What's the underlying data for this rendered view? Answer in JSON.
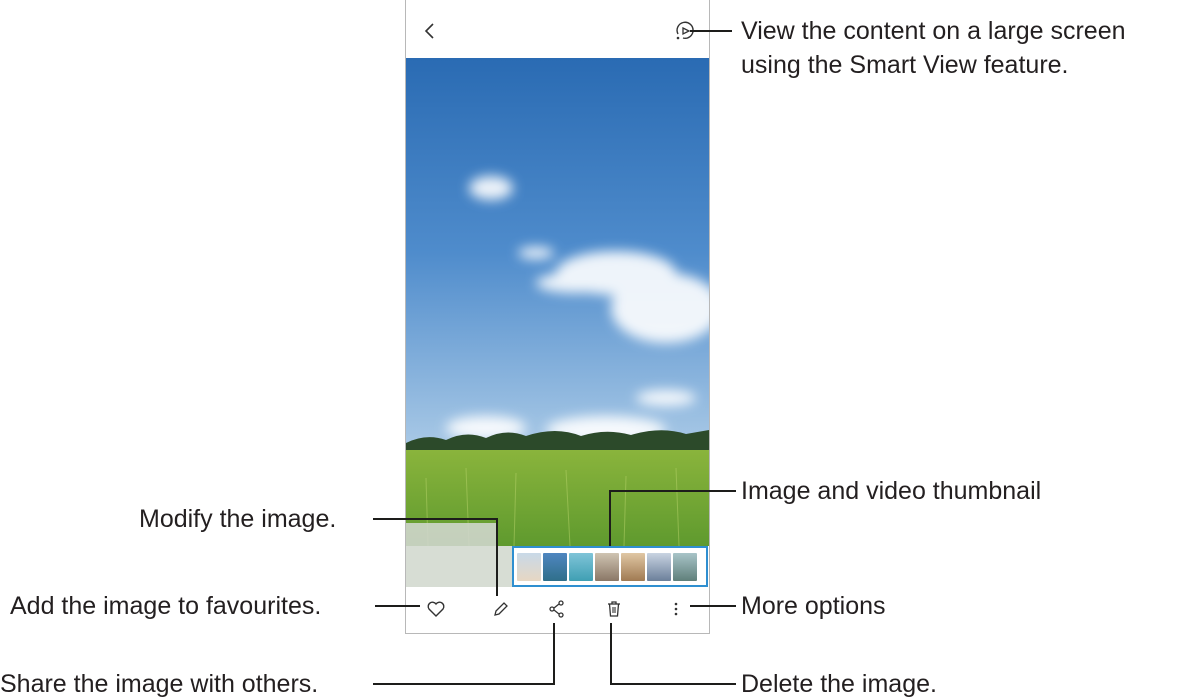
{
  "annotations": {
    "smart_view_line1": "View the content on a large screen",
    "smart_view_line2": "using the Smart View feature.",
    "thumbnails": "Image and video thumbnail",
    "modify": "Modify the image.",
    "favourites": "Add the image to favourites.",
    "more_options": "More options",
    "share": "Share the image with others.",
    "delete": "Delete the image."
  },
  "toolbar": {
    "back_icon": "chevron-left-icon",
    "smart_view_icon": "smart-view-icon"
  },
  "bottom_bar": {
    "icons": [
      "heart-icon",
      "pencil-icon",
      "share-icon",
      "trash-icon",
      "more-vertical-icon"
    ]
  },
  "thumbnails": {
    "count": 7,
    "colors": [
      "#c8d9e8",
      "#4f86c0",
      "#3f9fb3",
      "#8a7766",
      "#a07a52",
      "#6b7f9a",
      "#5f7f7a"
    ]
  }
}
